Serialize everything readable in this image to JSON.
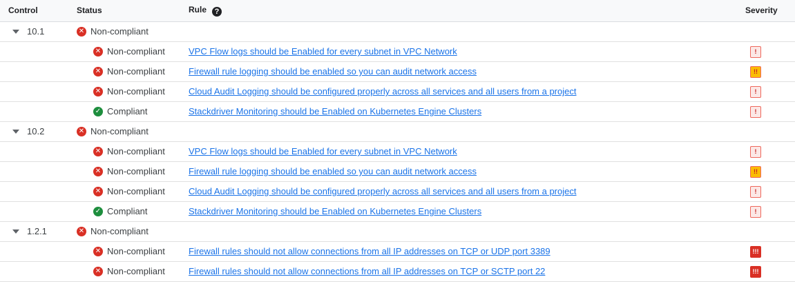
{
  "headers": {
    "control": "Control",
    "status": "Status",
    "rule": "Rule",
    "severity": "Severity",
    "help_glyph": "?"
  },
  "groups": [
    {
      "control": "10.1",
      "status": "Non-compliant",
      "rules": [
        {
          "status": "Non-compliant",
          "state": "bad",
          "rule": "VPC Flow logs should be Enabled for every subnet in VPC Network",
          "severity": "low",
          "sev_glyph": "!"
        },
        {
          "status": "Non-compliant",
          "state": "bad",
          "rule": "Firewall rule logging should be enabled so you can audit network access",
          "severity": "medium",
          "sev_glyph": "!!"
        },
        {
          "status": "Non-compliant",
          "state": "bad",
          "rule": "Cloud Audit Logging should be configured properly across all services and all users from a project",
          "severity": "low",
          "sev_glyph": "!"
        },
        {
          "status": "Compliant",
          "state": "ok",
          "rule": "Stackdriver Monitoring should be Enabled on Kubernetes Engine Clusters",
          "severity": "low",
          "sev_glyph": "!"
        }
      ]
    },
    {
      "control": "10.2",
      "status": "Non-compliant",
      "rules": [
        {
          "status": "Non-compliant",
          "state": "bad",
          "rule": "VPC Flow logs should be Enabled for every subnet in VPC Network",
          "severity": "low",
          "sev_glyph": "!"
        },
        {
          "status": "Non-compliant",
          "state": "bad",
          "rule": "Firewall rule logging should be enabled so you can audit network access",
          "severity": "medium",
          "sev_glyph": "!!"
        },
        {
          "status": "Non-compliant",
          "state": "bad",
          "rule": "Cloud Audit Logging should be configured properly across all services and all users from a project",
          "severity": "low",
          "sev_glyph": "!"
        },
        {
          "status": "Compliant",
          "state": "ok",
          "rule": "Stackdriver Monitoring should be Enabled on Kubernetes Engine Clusters",
          "severity": "low",
          "sev_glyph": "!"
        }
      ]
    },
    {
      "control": "1.2.1",
      "status": "Non-compliant",
      "rules": [
        {
          "status": "Non-compliant",
          "state": "bad",
          "rule": "Firewall rules should not allow connections from all IP addresses on TCP or UDP port 3389",
          "severity": "high",
          "sev_glyph": "!!!"
        },
        {
          "status": "Non-compliant",
          "state": "bad",
          "rule": "Firewall rules should not allow connections from all IP addresses on TCP or SCTP port 22",
          "severity": "high",
          "sev_glyph": "!!!"
        }
      ]
    }
  ],
  "icons": {
    "bad": "close-circle-icon",
    "ok": "check-circle-icon"
  },
  "icon_glyphs": {
    "bad": "✕",
    "ok": "✓",
    "caret": "caret-down-icon"
  },
  "colors": {
    "link": "#1a73e8",
    "error": "#d93025",
    "success": "#1e8e3e",
    "warning": "#fbbc04"
  }
}
